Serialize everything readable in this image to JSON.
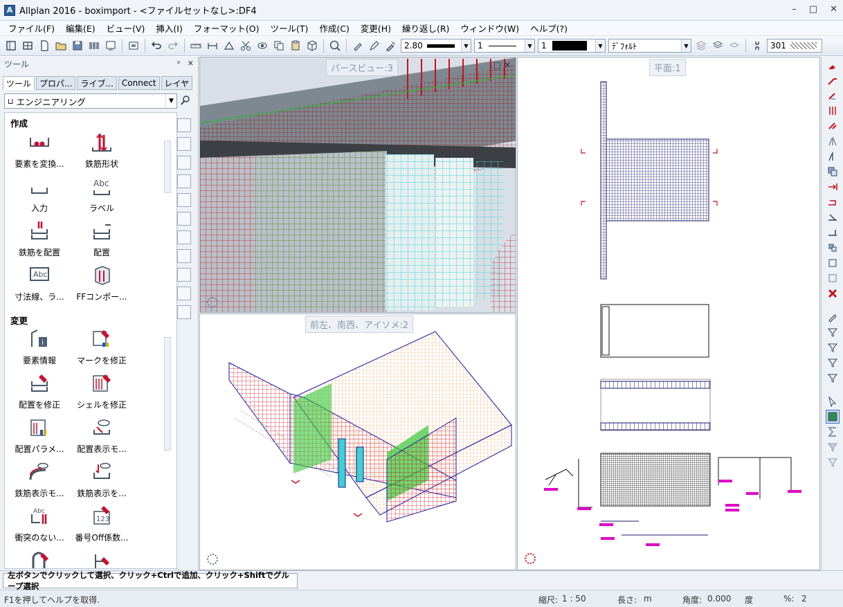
{
  "window": {
    "title": "Allplan 2016 - boximport - <ファイルセットなし>:DF4",
    "controls": [
      "–",
      "□",
      "✕"
    ]
  },
  "menu": [
    "ファイル(F)",
    "編集(E)",
    "ビュー(V)",
    "挿入(I)",
    "フォーマット(O)",
    "ツール(T)",
    "作成(C)",
    "変更(H)",
    "繰り返し(R)",
    "ウィンドウ(W)",
    "ヘルプ(?)"
  ],
  "toolbar": {
    "pen_value": "2.80",
    "line_value": "1",
    "color_value": "1",
    "layer_value": "ﾃﾞﾌｫﾙﾄ",
    "hatch_value": "301"
  },
  "panel": {
    "title": "ツール",
    "tabs": [
      "ツール",
      "プロパ...",
      "ライブ...",
      "Connect",
      "レイヤ"
    ],
    "module": "エンジニアリング",
    "sections": [
      {
        "label": "作成",
        "tools": [
          "要素を変換...",
          "鉄筋形状",
          "入力",
          "ラベル",
          "鉄筋を配置",
          "配置",
          "寸法線、ラ...",
          "FFコンポー..."
        ]
      },
      {
        "label": "変更",
        "tools": [
          "要素情報",
          "マークを修正",
          "配置を修正",
          "シェルを修正",
          "配置パラメ...",
          "配置表示モ...",
          "鉄筋表示モ...",
          "鉄筋表示を...",
          "衝突のない...",
          "番号Off係数..."
        ]
      }
    ]
  },
  "viewports": {
    "perspective": "パースビュー:3",
    "iso": "前左、南西、アイソメ:2",
    "plan": "平面:1"
  },
  "prompt": "左ボタンでクリックして選択、クリック+Ctrlで追加、クリック+Shiftでグループ選択",
  "status": {
    "help": "F1を押してヘルプを取得.",
    "scale_label": "縮尺:",
    "scale_value": "1 : 50",
    "length_label": "長さ:",
    "length_value": "m",
    "angle_label": "角度:",
    "angle_value": "0.000",
    "angle_unit": "度",
    "percent_label": "%:",
    "percent_value": "2"
  },
  "colors": {
    "rebar_red": "#c8101c",
    "rebar_green": "#2eb82e",
    "rebar_cyan": "#3fd6d6",
    "plan_navy": "#1a1a6e",
    "accent_magenta": "#e000c8"
  }
}
